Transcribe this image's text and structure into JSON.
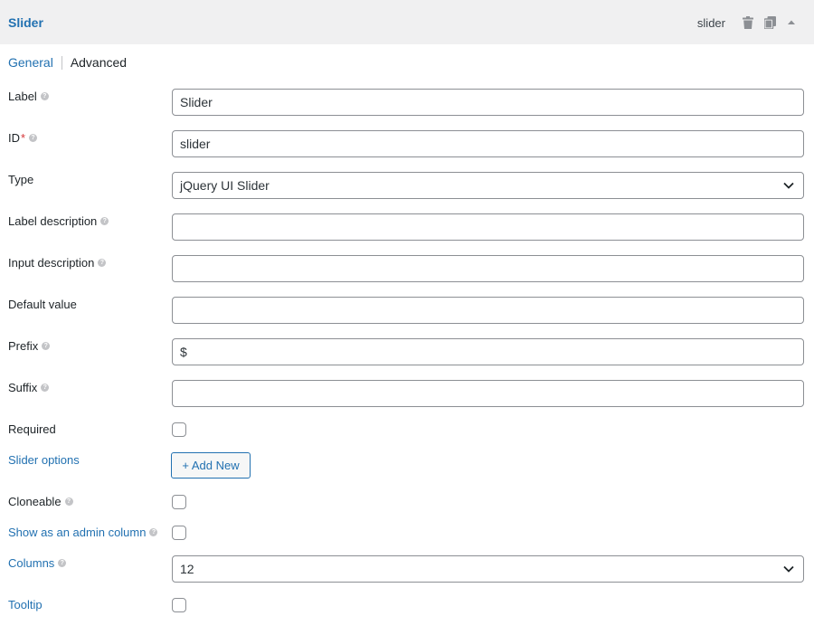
{
  "header": {
    "title": "Slider",
    "field_id": "slider",
    "icons": [
      "trash-icon",
      "duplicate-icon",
      "collapse-arrow-icon"
    ]
  },
  "tabs": {
    "general": "General",
    "advanced": "Advanced"
  },
  "fields": {
    "label": {
      "label": "Label",
      "value": "Slider"
    },
    "id": {
      "label": "ID",
      "required_mark": "*",
      "value": "slider"
    },
    "type": {
      "label": "Type",
      "value": "jQuery UI Slider"
    },
    "label_description": {
      "label": "Label description",
      "value": ""
    },
    "input_description": {
      "label": "Input description",
      "value": ""
    },
    "default_value": {
      "label": "Default value",
      "value": ""
    },
    "prefix": {
      "label": "Prefix",
      "value": "$"
    },
    "suffix": {
      "label": "Suffix",
      "value": ""
    },
    "required": {
      "label": "Required",
      "checked": false
    },
    "slider_options": {
      "label": "Slider options",
      "button": "+ Add New"
    },
    "cloneable": {
      "label": "Cloneable",
      "checked": false
    },
    "admin_column": {
      "label": "Show as an admin column",
      "checked": false
    },
    "columns": {
      "label": "Columns",
      "value": "12"
    },
    "tooltip": {
      "label": "Tooltip",
      "checked": false
    }
  },
  "colors": {
    "accent": "#2271b1",
    "header_bg": "#f0f0f1",
    "required": "#d63638"
  }
}
